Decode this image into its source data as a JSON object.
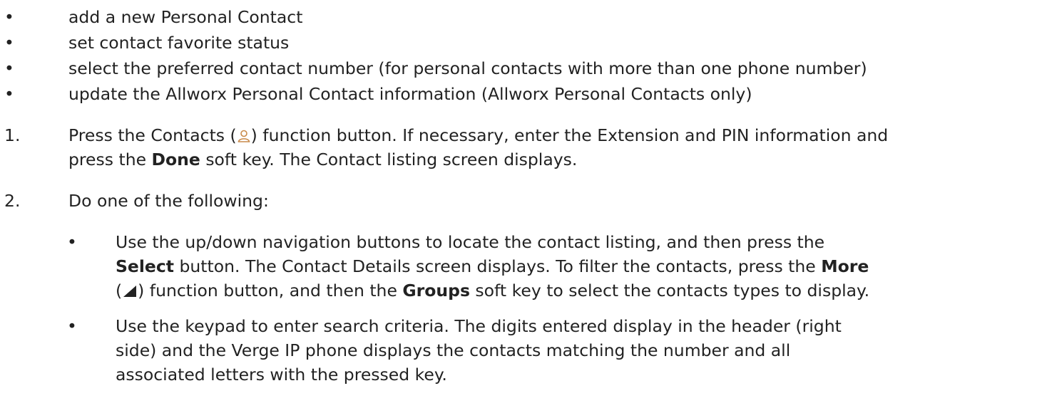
{
  "bullets": [
    "add a new Personal Contact",
    "set contact favorite status",
    "select the preferred contact number (for personal contacts with more than one phone number)",
    "update the Allworx Personal Contact information (Allworx Personal Contacts only)"
  ],
  "bullet_char": "•",
  "step1": {
    "num": "1.",
    "line1_a": "Press the Contacts (",
    "line1_b": ") function button. If necessary, enter the Extension and PIN information and",
    "line2_a": "press the ",
    "line2_bold": "Done",
    "line2_b": " soft key. The Contact listing screen displays."
  },
  "step2": {
    "num": "2.",
    "text": "Do one of the following:"
  },
  "sub1": {
    "line1": "Use the up/down navigation buttons to locate the contact listing, and then press the",
    "line2_bold1": "Select",
    "line2_a": " button. The Contact Details screen displays. To filter the contacts, press the ",
    "line2_bold2": "More",
    "line3_a": "(",
    "line3_b": ") function button, and then the ",
    "line3_bold": "Groups",
    "line3_c": " soft key to select the contacts types to display."
  },
  "sub2": {
    "line1": "Use the keypad to enter search criteria. The digits entered display in the header (right",
    "line2": "side) and the Verge IP phone displays the contacts matching the number and all",
    "line3": "associated letters with the pressed key."
  },
  "icons": {
    "contacts": "person-icon",
    "more": "triangle-icon"
  }
}
